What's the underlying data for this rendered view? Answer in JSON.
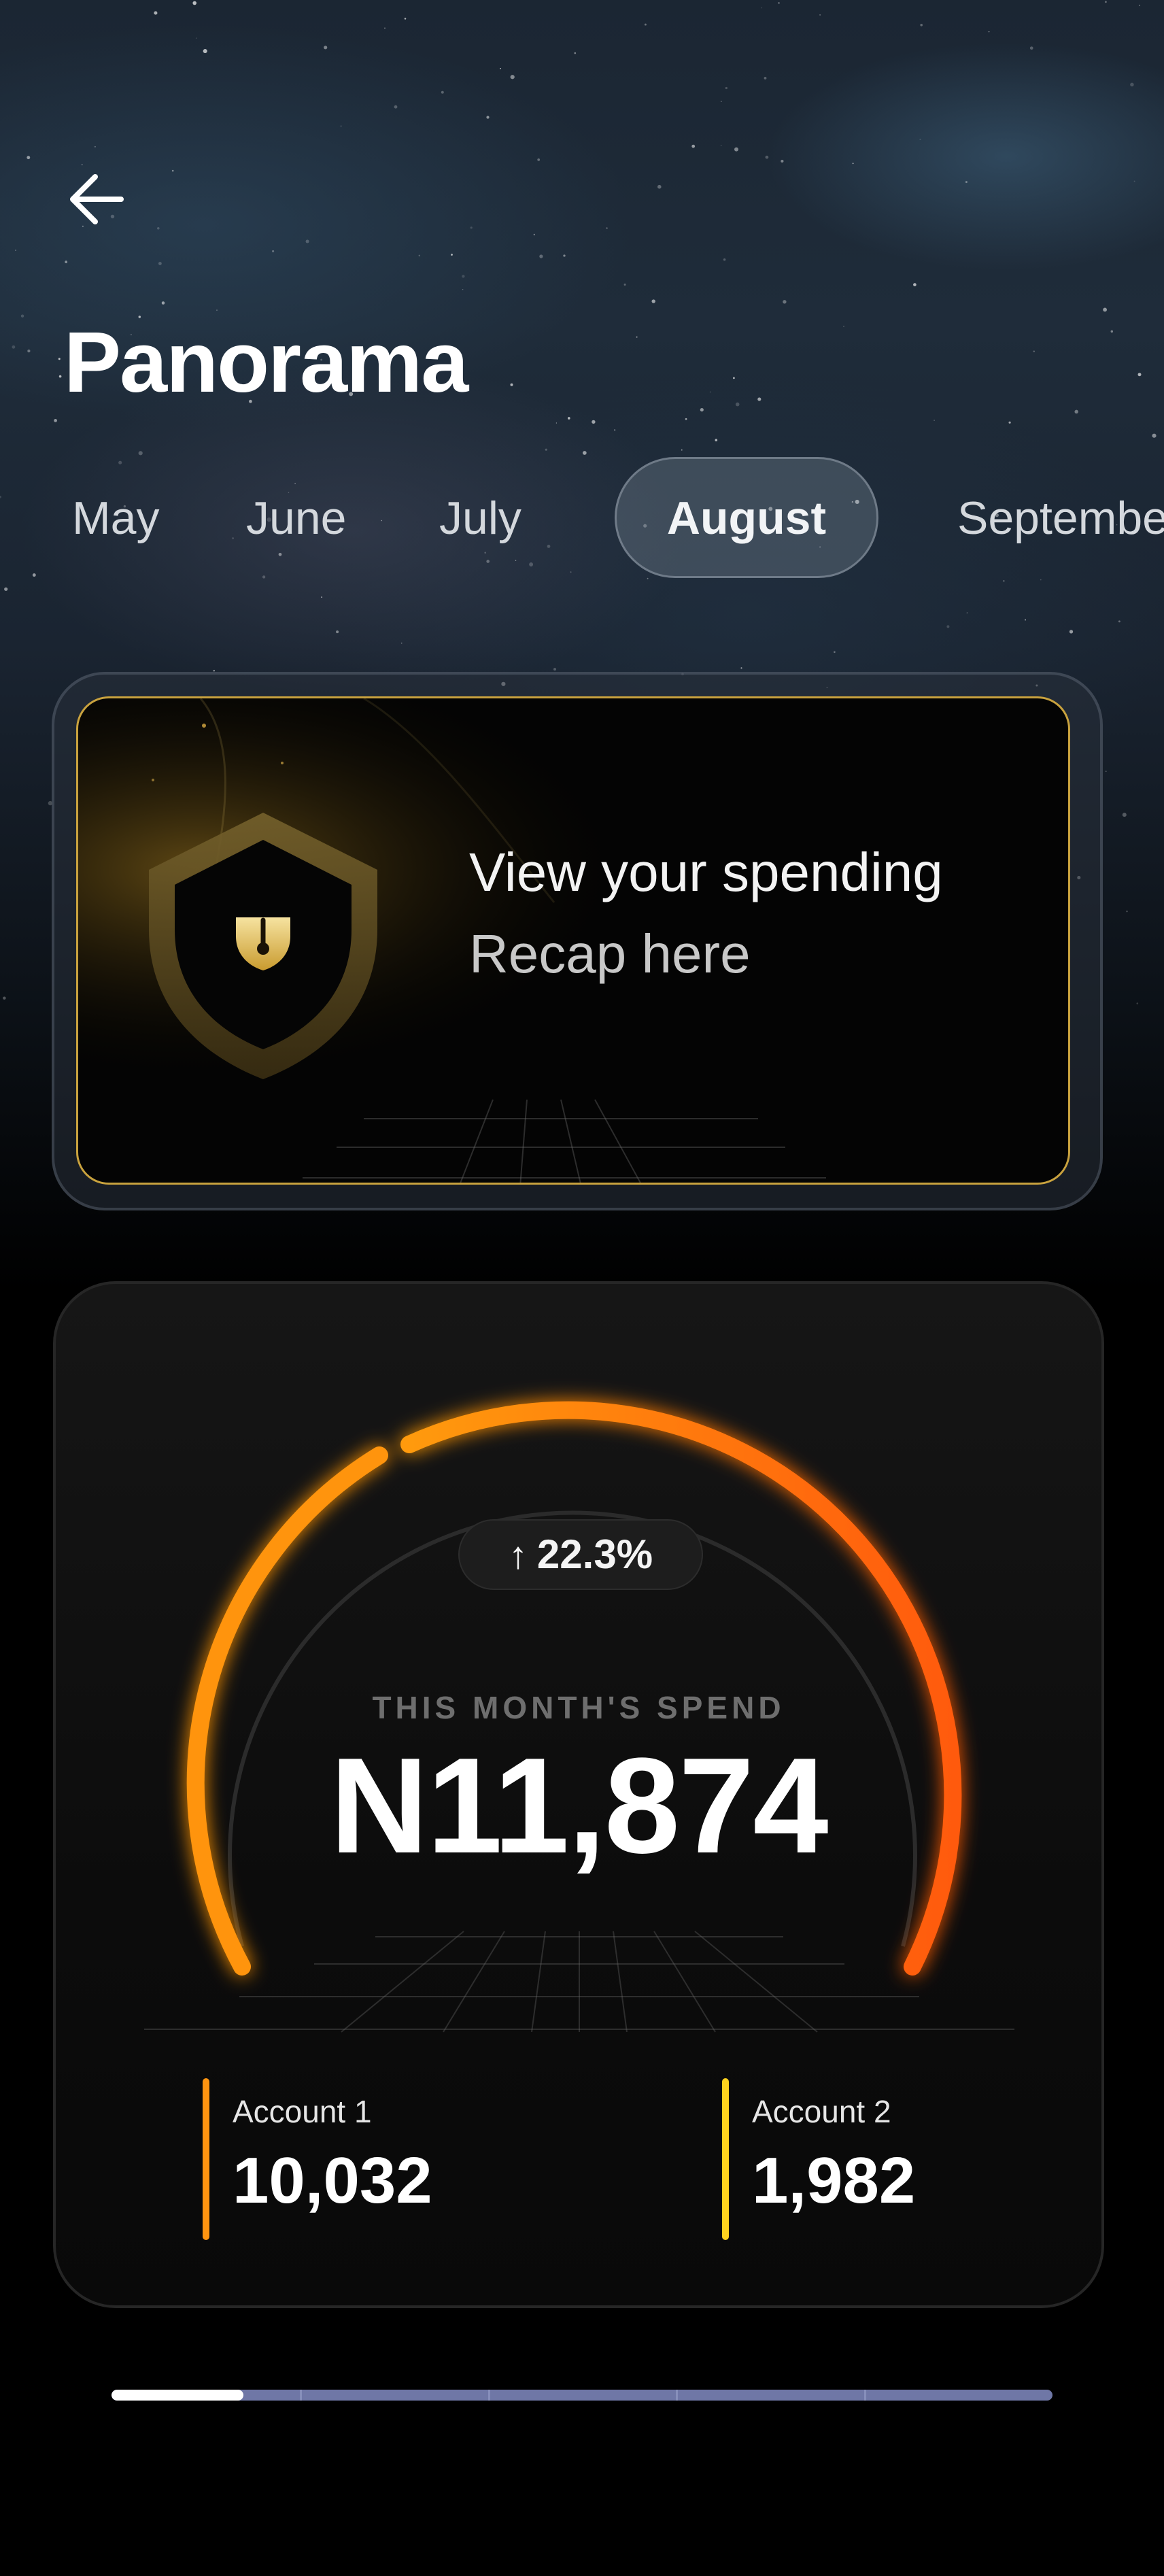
{
  "header": {
    "title": "Panorama",
    "back_icon": "arrow-left-icon"
  },
  "months": {
    "items": [
      "May",
      "June",
      "July",
      "August",
      "September"
    ],
    "selected": "August"
  },
  "recap_card": {
    "line1": "View your spending",
    "line2": "Recap here",
    "icon": "shield-lock-icon",
    "accent_color": "#c9a23e"
  },
  "spend": {
    "change_icon": "arrow-up-icon",
    "change_text": "22.3%",
    "label": "THIS MONTH'S SPEND",
    "amount": "N11,874",
    "gauge_colors": [
      "#ff9a10",
      "#ff5a0a"
    ],
    "accounts": [
      {
        "name": "Account 1",
        "value": "10,032",
        "color": "#ff9410"
      },
      {
        "name": "Account 2",
        "value": "1,982",
        "color": "#ffd21e"
      }
    ]
  },
  "progress": {
    "fraction": 0.14,
    "segments": 5
  }
}
